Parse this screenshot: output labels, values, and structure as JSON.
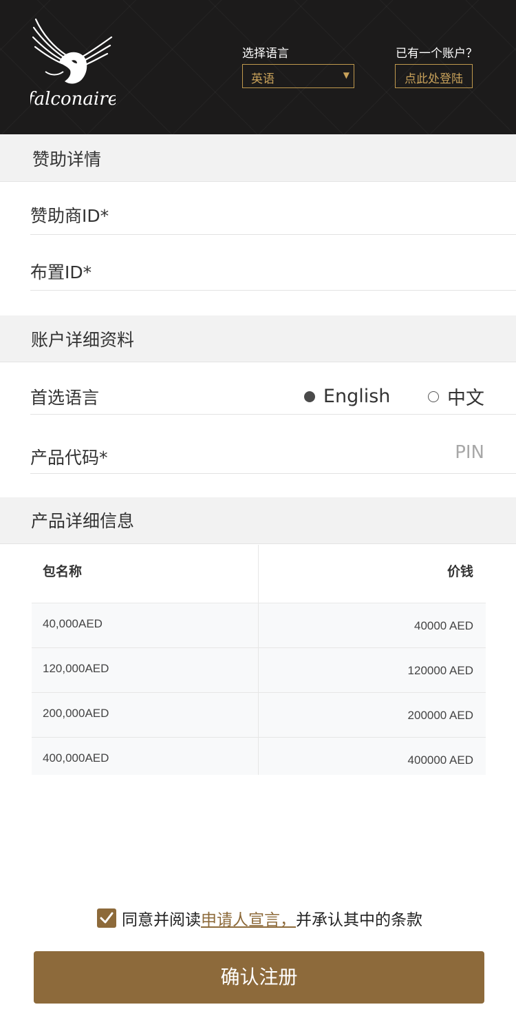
{
  "header": {
    "language_label": "选择语言",
    "language_selected": "英语",
    "account_prompt": "已有一个账户？",
    "login_label": "点此处登陆"
  },
  "sponsor_section": {
    "title": "赞助详情",
    "sponsor_id_label": "赞助商ID*",
    "placement_id_label": "布置ID*"
  },
  "account_section": {
    "title": "账户详细资料",
    "preferred_language_label": "首选语言",
    "options": [
      {
        "label": "English",
        "selected": true
      },
      {
        "label": "中文",
        "selected": false
      }
    ],
    "product_code_label": "产品代码*",
    "product_code_placeholder": "PIN"
  },
  "product_section": {
    "title": "产品详细信息",
    "columns": [
      "包名称",
      "价钱"
    ],
    "rows": [
      {
        "name": "40,000AED",
        "price": "40000 AED"
      },
      {
        "name": "120,000AED",
        "price": "120000 AED"
      },
      {
        "name": "200,000AED",
        "price": "200000 AED"
      },
      {
        "name": "400,000AED",
        "price": "400000 AED"
      }
    ]
  },
  "agreement": {
    "checked": true,
    "prefix": "同意并阅读",
    "link": "申请人宣言，",
    "suffix": "并承认其中的条款"
  },
  "submit_label": "确认注册",
  "colors": {
    "accent": "#8d6a3b",
    "header_bg": "#1c1b1b",
    "header_gold": "#c9a25a"
  }
}
